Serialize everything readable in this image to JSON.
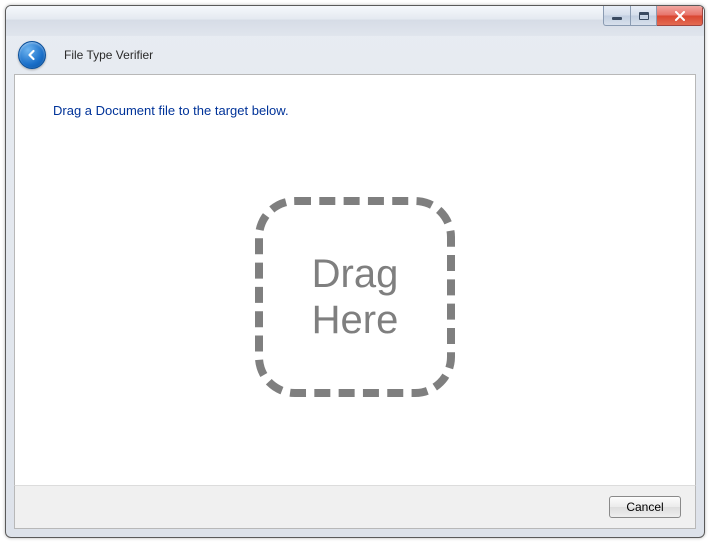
{
  "header": {
    "app_title": "File Type Verifier"
  },
  "main": {
    "instruction": "Drag a Document file to the target below.",
    "drop_line1": "Drag",
    "drop_line2": "Here"
  },
  "footer": {
    "cancel_label": "Cancel"
  }
}
